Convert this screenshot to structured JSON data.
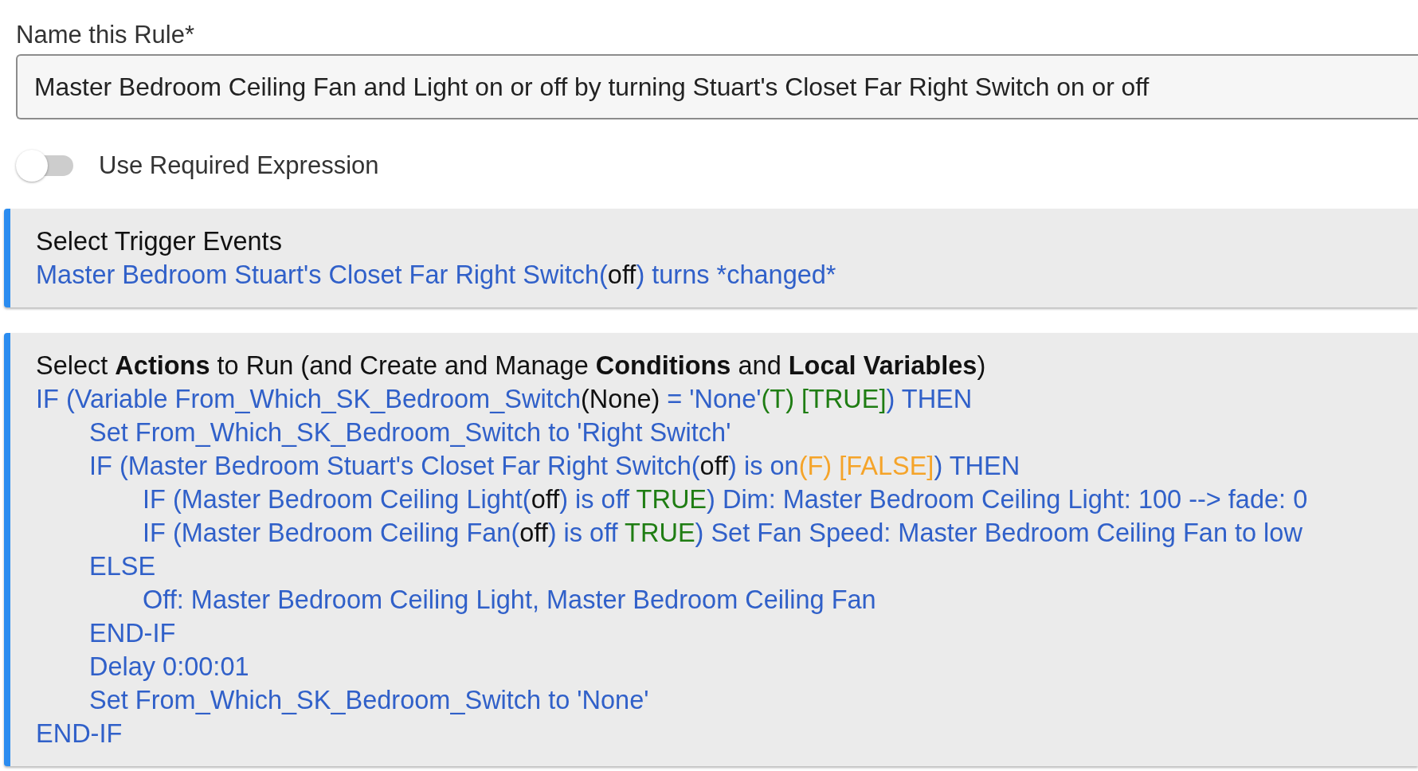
{
  "rule_name": {
    "label": "Name this Rule*",
    "value": "Master Bedroom Ceiling Fan and Light on or off by turning Stuart's Closet Far Right Switch on or off"
  },
  "required_expression": {
    "label": "Use Required Expression",
    "on": false
  },
  "trigger_events": {
    "title": "Select Trigger Events",
    "lines": [
      {
        "segments": [
          {
            "kind": "text",
            "text": "Master Bedroom Stuart's Closet Far Right Switch("
          },
          {
            "kind": "value",
            "text": "off"
          },
          {
            "kind": "text",
            "text": ") turns *changed*"
          }
        ]
      }
    ]
  },
  "actions": {
    "title": "Select **Actions** to Run (and Create and Manage **Conditions** and **Local Variables**)",
    "lines": [
      {
        "segments": [
          {
            "kind": "text",
            "text": "IF (Variable From_Which_SK_Bedroom_Switch"
          },
          {
            "kind": "value",
            "text": "(None)"
          },
          {
            "kind": "text",
            "text": " = 'None'"
          },
          {
            "kind": "true",
            "text": "(T) [TRUE]"
          },
          {
            "kind": "text",
            "text": ") THEN"
          }
        ],
        "children": [
          {
            "segments": [
              {
                "kind": "text",
                "text": "Set From_Which_SK_Bedroom_Switch to 'Right Switch'"
              }
            ]
          },
          {
            "segments": [
              {
                "kind": "text",
                "text": "IF (Master Bedroom Stuart's Closet Far Right Switch("
              },
              {
                "kind": "value",
                "text": "off"
              },
              {
                "kind": "text",
                "text": ") is on"
              },
              {
                "kind": "false",
                "text": "(F) [FALSE]"
              },
              {
                "kind": "text",
                "text": ") THEN"
              }
            ],
            "children": [
              {
                "segments": [
                  {
                    "kind": "text",
                    "text": "IF (Master Bedroom Ceiling Light("
                  },
                  {
                    "kind": "value",
                    "text": "off"
                  },
                  {
                    "kind": "text",
                    "text": ") is off "
                  },
                  {
                    "kind": "true",
                    "text": "TRUE"
                  },
                  {
                    "kind": "text",
                    "text": ") Dim: Master Bedroom Ceiling Light: 100 --> fade: 0"
                  }
                ]
              },
              {
                "segments": [
                  {
                    "kind": "text",
                    "text": "IF (Master Bedroom Ceiling Fan("
                  },
                  {
                    "kind": "value",
                    "text": "off"
                  },
                  {
                    "kind": "text",
                    "text": ") is off "
                  },
                  {
                    "kind": "true",
                    "text": "TRUE"
                  },
                  {
                    "kind": "text",
                    "text": ") Set Fan Speed: Master Bedroom Ceiling Fan to low"
                  }
                ]
              }
            ]
          },
          {
            "segments": [
              {
                "kind": "text",
                "text": "ELSE"
              }
            ],
            "children": [
              {
                "segments": [
                  {
                    "kind": "text",
                    "text": "Off: Master Bedroom Ceiling Light, Master Bedroom Ceiling Fan"
                  }
                ]
              }
            ]
          },
          {
            "segments": [
              {
                "kind": "text",
                "text": "END-IF"
              }
            ]
          },
          {
            "segments": [
              {
                "kind": "text",
                "text": "Delay 0:00:01"
              }
            ]
          },
          {
            "segments": [
              {
                "kind": "text",
                "text": "Set From_Which_SK_Bedroom_Switch to 'None'"
              }
            ]
          }
        ]
      },
      {
        "segments": [
          {
            "kind": "text",
            "text": "END-IF"
          }
        ]
      }
    ]
  }
}
